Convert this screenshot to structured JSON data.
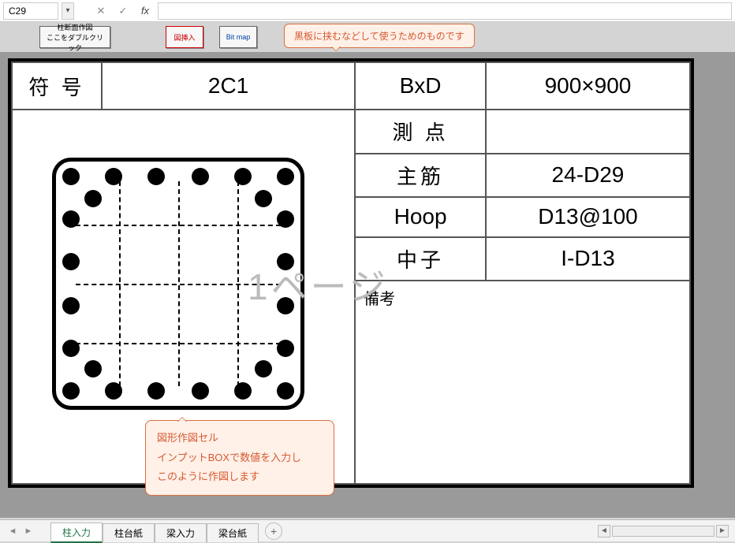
{
  "namebox": "C29",
  "toolbar": {
    "btn1_line1": "柱断面作図",
    "btn1_line2": "ここをダブルクリック",
    "btn2": "図挿入",
    "btn3": "Bit map"
  },
  "callout_top": "黒板に挟むなどして使うためのものです",
  "callout_bottom": {
    "l1": "図形作図セル",
    "l2": "インプットBOXで数値を入力し",
    "l3": "このように作図します"
  },
  "page_watermark": "1ページ",
  "labels": {
    "fugou": "符 号",
    "bxd": "BxD",
    "sokuten": "測 点",
    "shukin": "主筋",
    "hoop": "Hoop",
    "nakago": "中子",
    "bikou": "備考"
  },
  "values": {
    "fugou": "2C1",
    "bxd": "900×900",
    "sokuten": "",
    "shukin": "24-D29",
    "hoop": "D13@100",
    "nakago": "I-D13",
    "bikou": ""
  },
  "sheet_tabs": [
    "柱入力",
    "柱台紙",
    "梁入力",
    "梁台紙"
  ],
  "active_tab_index": 0
}
